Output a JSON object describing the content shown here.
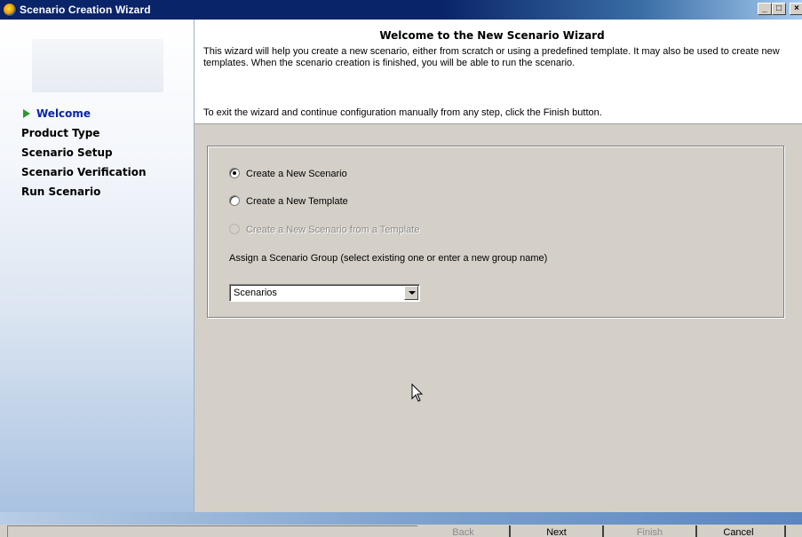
{
  "window": {
    "title": "Scenario Creation Wizard"
  },
  "sidebar": {
    "steps": [
      {
        "label": "Welcome",
        "active": true
      },
      {
        "label": "Product Type"
      },
      {
        "label": "Scenario Setup"
      },
      {
        "label": "Scenario Verification"
      },
      {
        "label": "Run Scenario"
      }
    ]
  },
  "header": {
    "title": "Welcome to the New Scenario Wizard",
    "description": "This wizard will help you create a new scenario, either from scratch or using a predefined template. It may also be used to create new templates. When the scenario creation is finished, you will be able to run the scenario.",
    "exit_note": "To exit the wizard and continue configuration manually from any step, click the Finish button."
  },
  "options": {
    "new_scenario": "Create a New Scenario",
    "new_template": "Create a New Template",
    "from_template": "Create a New Scenario from a Template",
    "selected": "new_scenario"
  },
  "group": {
    "label": "Assign a Scenario Group (select existing one or enter a new group name)",
    "value": "Scenarios"
  },
  "footer": {
    "back": "Back",
    "next": "Next",
    "finish": "Finish",
    "cancel": "Cancel"
  }
}
